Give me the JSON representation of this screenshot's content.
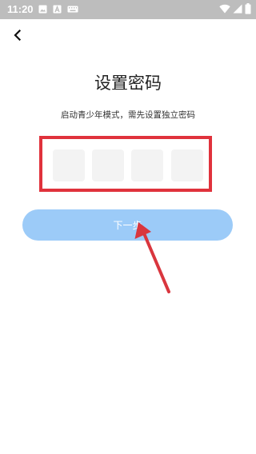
{
  "status_bar": {
    "time": "11:20",
    "icons": [
      "gallery-icon",
      "a-letter-icon",
      "keyboard-icon",
      "wifi-icon",
      "signal-icon",
      "battery-icon"
    ]
  },
  "header": {
    "back_icon": "chevron-left-icon"
  },
  "main": {
    "title": "设置密码",
    "subtitle": "启动青少年模式，需先设置独立密码",
    "code_cells": [
      "",
      "",
      "",
      ""
    ],
    "next_button_label": "下一步"
  },
  "colors": {
    "status_bar": "#bdbdbd",
    "highlight_border": "#e0323c",
    "button_bg": "#9ccbf8",
    "cell_bg": "#f3f3f3",
    "arrow": "#d9363e"
  }
}
